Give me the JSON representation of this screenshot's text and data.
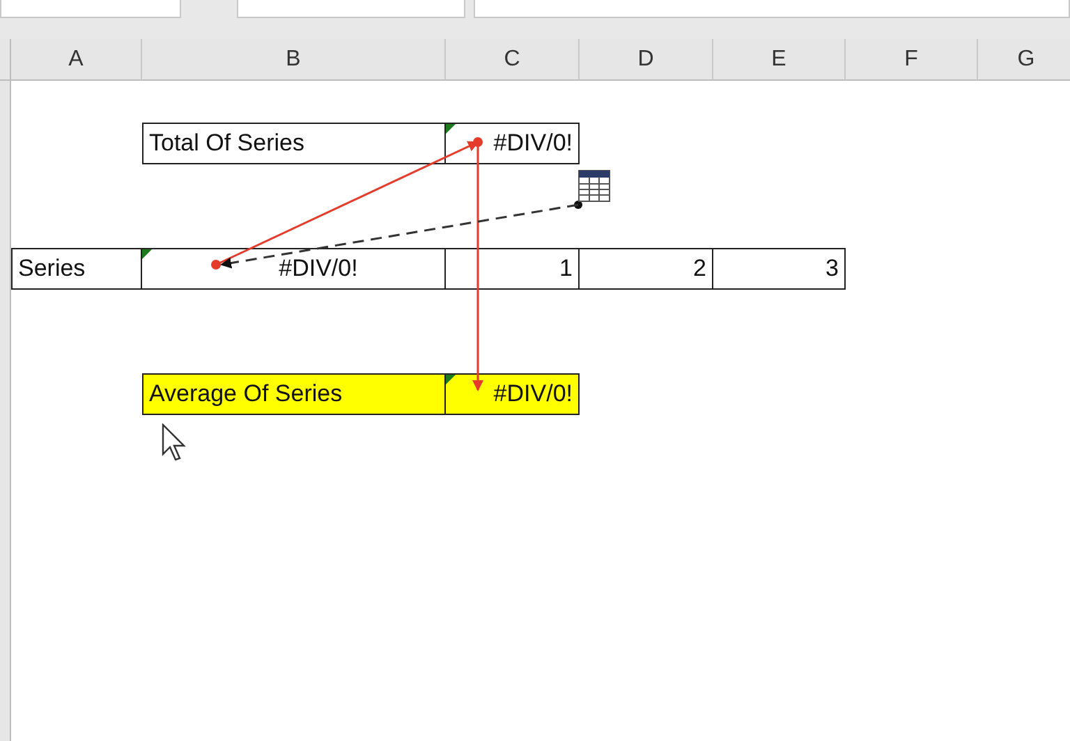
{
  "columns": [
    "A",
    "B",
    "C",
    "D",
    "E",
    "F",
    "G"
  ],
  "total_row": {
    "label": "Total Of Series",
    "value": "#DIV/0!",
    "flagged": true
  },
  "series_row": {
    "label": "Series",
    "result": "#DIV/0!",
    "result_flagged": true,
    "values": [
      "1",
      "2",
      "3"
    ]
  },
  "average_row": {
    "label": "Average Of Series",
    "value": "#DIV/0!",
    "flagged": true,
    "highlighted": true
  }
}
